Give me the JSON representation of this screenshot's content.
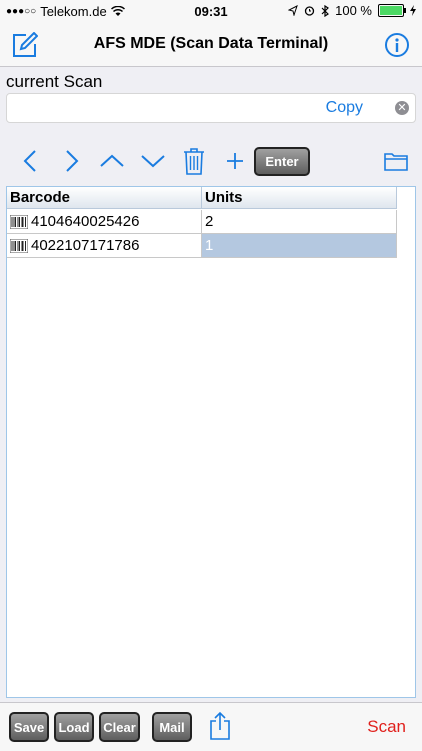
{
  "status": {
    "carrier": "Telekom.de",
    "time": "09:31",
    "battery": "100 %",
    "colors": {
      "battery_fill": "#4cd964"
    }
  },
  "nav": {
    "title": "AFS MDE (Scan Data Terminal)",
    "left_icon": "compose-icon",
    "right_icon": "info-icon"
  },
  "scan": {
    "label": "current Scan",
    "value": "",
    "copy_label": "Copy"
  },
  "toolbar": {
    "icons": [
      "chevron-left-icon",
      "chevron-right-icon",
      "chevron-up-icon",
      "chevron-down-icon",
      "trash-icon",
      "plus-icon",
      "folder-icon"
    ],
    "enter_label": "Enter"
  },
  "table": {
    "columns": [
      "Barcode",
      "Units"
    ],
    "rows": [
      {
        "barcode": "4104640025426",
        "units": "2"
      },
      {
        "barcode": "4022107171786",
        "units": "1"
      }
    ],
    "selected_row": 1
  },
  "bottom": {
    "save_label": "Save",
    "load_label": "Load",
    "clear_label": "Clear",
    "mail_label": "Mail",
    "scan_label": "Scan",
    "colors": {
      "accent": "#1a7ce0",
      "scan": "#e0201c"
    }
  }
}
